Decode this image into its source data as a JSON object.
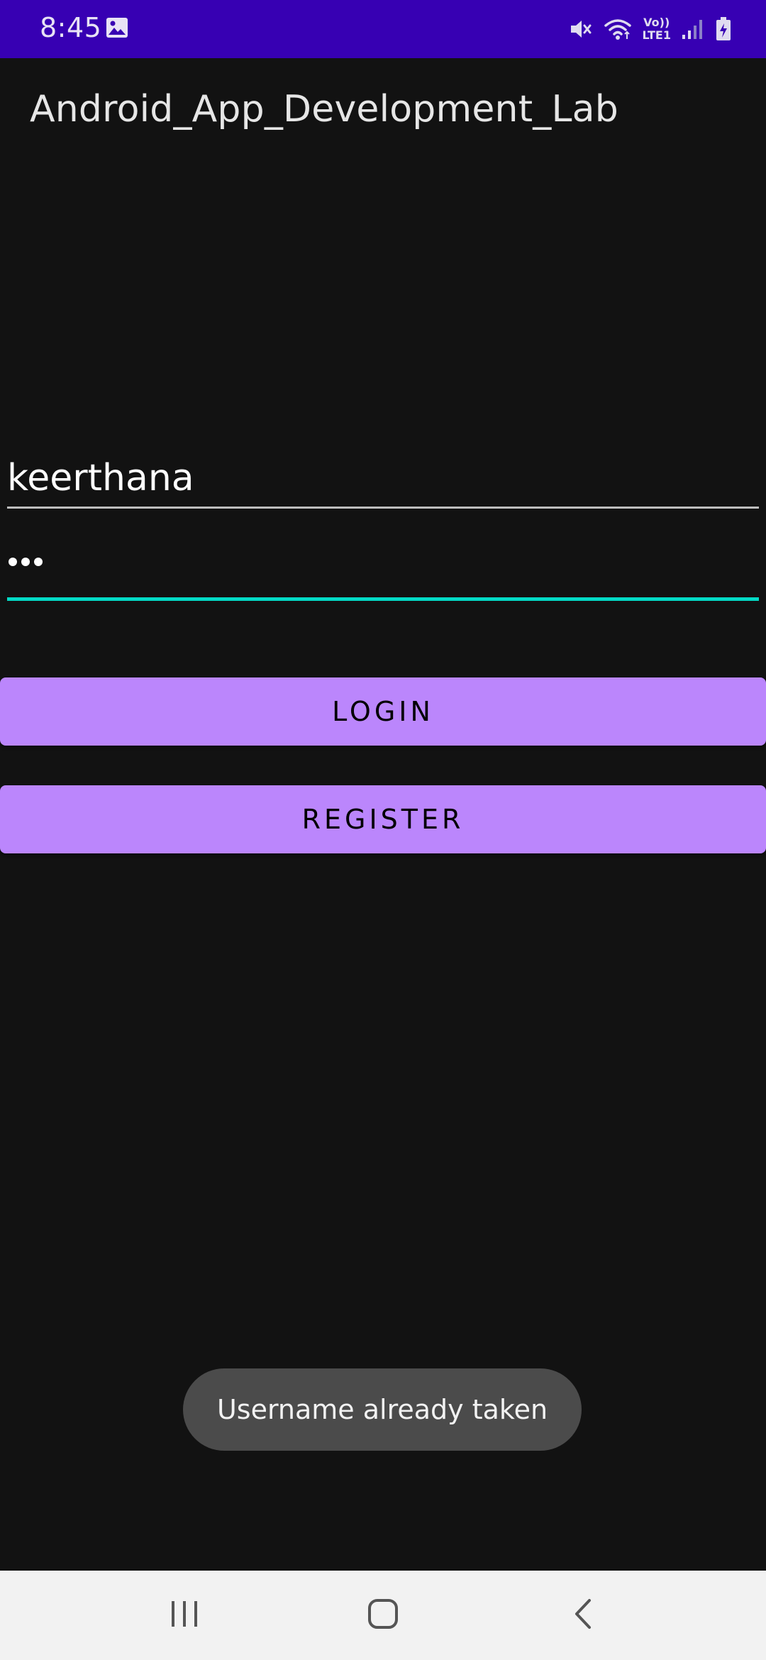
{
  "status_bar": {
    "time": "8:45",
    "volte_top": "Vo))",
    "volte_bottom": "LTE1",
    "icons": [
      "gallery-icon",
      "mute-icon",
      "wifi-icon",
      "signal-icon",
      "battery-icon"
    ],
    "background_color": "#3700B3"
  },
  "app_bar": {
    "title": "Android_App_Development_Lab"
  },
  "form": {
    "username_value": "keerthana",
    "password_mask_length": 3
  },
  "buttons": {
    "login_label": "LOGIN",
    "register_label": "REGISTER",
    "accent_color": "#BB86FC"
  },
  "toast": {
    "message": "Username already taken"
  },
  "nav_bar": {
    "items": [
      "recents-icon",
      "home-icon",
      "back-icon"
    ]
  },
  "colors": {
    "background": "#121212",
    "field_focus": "#03DAC5"
  }
}
